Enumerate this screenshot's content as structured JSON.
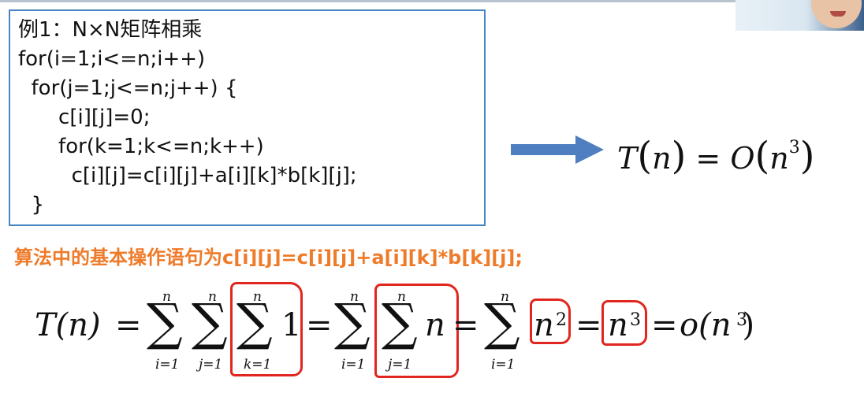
{
  "code_block": {
    "lines": [
      "例1：N×N矩阵相乘",
      "for(i=1;i<=n;i++)",
      "  for(j=1;j<=n;j++) {",
      "    c[i][j]=0;",
      "    for(k=1;k<=n;k++)",
      "      c[i][j]=c[i][j]+a[i][k]*b[k][j];",
      "  }"
    ]
  },
  "result": {
    "t": "T",
    "n": "n",
    "eq": "=",
    "o": "O",
    "exp": "3"
  },
  "statement": "算法中的基本操作语句为c[i][j]=c[i][j]+a[i][k]*b[k][j];",
  "equation": {
    "lhs": "T(n)",
    "eq": "=",
    "sum_upper": "n",
    "i_lower": "i=1",
    "j_lower": "j=1",
    "k_lower": "k=1",
    "one": "1",
    "n_term": "n",
    "n_base": "n",
    "exp2": "2",
    "exp3": "3",
    "final": "o(n",
    "final_close": ")"
  },
  "colors": {
    "code_border": "#4a86c5",
    "arrow": "#4f7fc1",
    "statement": "#ee7b2a",
    "annotation": "#e0261e"
  }
}
